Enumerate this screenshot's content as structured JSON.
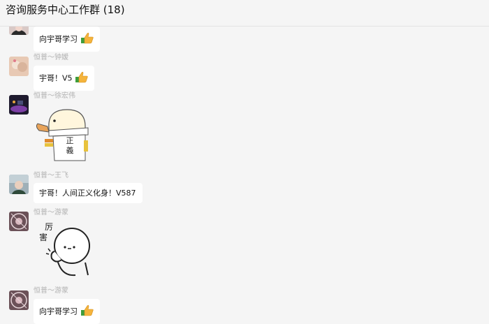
{
  "window": {
    "title": "咨询服务中心工作群 (18)"
  },
  "messages": [
    {
      "sender": "",
      "text": "向宇哥学习",
      "emoji": "thumbs-up"
    },
    {
      "sender": "恒普～钟嫒",
      "text": "宇哥！V5",
      "emoji": "thumbs-up"
    },
    {
      "sender": "恒普～徐宏伟",
      "sticker": "duck-sticker",
      "sticker_text": "正義"
    },
    {
      "sender": "恒普～王飞",
      "text": "宇哥！人间正义化身！V587"
    },
    {
      "sender": "恒普～游蒙",
      "sticker": "thumbs-up-stickman-sticker",
      "sticker_text": "厉害"
    },
    {
      "sender": "恒普～游蒙",
      "text": "向宇哥学习",
      "emoji": "thumbs-up"
    }
  ],
  "colors": {
    "background": "#f5f5f5",
    "bubble": "#ffffff",
    "sender": "#b2b2b2",
    "emoji_thumb": "#f5b43c",
    "emoji_cuff": "#3f9d3c"
  }
}
